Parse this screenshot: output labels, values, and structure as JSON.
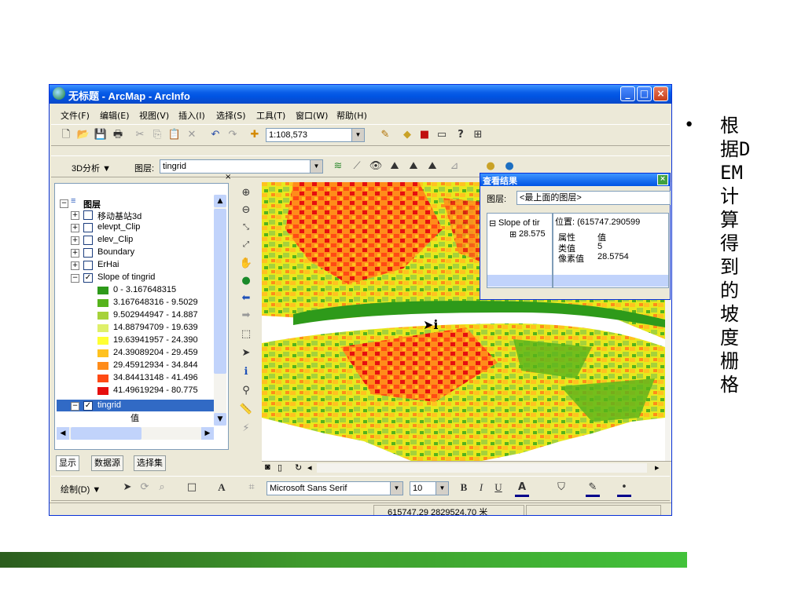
{
  "window": {
    "title": "无标题 - ArcMap - ArcInfo",
    "buttons": {
      "minimize": "_",
      "maximize": "□",
      "close": "×"
    }
  },
  "menu": [
    "文件(F)",
    "编辑(E)",
    "视图(V)",
    "插入(I)",
    "选择(S)",
    "工具(T)",
    "窗口(W)",
    "帮助(H)"
  ],
  "standard_toolbar": {
    "scale": "1:108,573"
  },
  "analyst_toolbar": {
    "analyst_label": "3D分析 ▼",
    "layer_label": "图层:",
    "layer_value": "tingrid"
  },
  "toc": {
    "root_label": "图层",
    "layers": [
      {
        "label": "移动基站3d",
        "checked": false
      },
      {
        "label": "elevpt_Clip",
        "checked": false
      },
      {
        "label": "elev_Clip",
        "checked": false
      },
      {
        "label": "Boundary",
        "checked": false
      },
      {
        "label": "ErHai",
        "checked": false
      },
      {
        "label": "Slope of tingrid",
        "checked": true
      }
    ],
    "legend": [
      {
        "label": "0 - 3.167648315",
        "color": "#2e9a1a"
      },
      {
        "label": "3.167648316 - 9.5029",
        "color": "#56b31c"
      },
      {
        "label": "9.502944947 - 14.887",
        "color": "#a6d23a"
      },
      {
        "label": "14.88794709 - 19.639",
        "color": "#dff06a"
      },
      {
        "label": "19.63941957 - 24.390",
        "color": "#ffff33"
      },
      {
        "label": "24.39089204 - 29.459",
        "color": "#ffc21f"
      },
      {
        "label": "29.45912934 - 34.844",
        "color": "#ff8c1a"
      },
      {
        "label": "34.84413148 - 41.496",
        "color": "#ff4a14"
      },
      {
        "label": "41.49619294 - 80.775",
        "color": "#e60f0f"
      }
    ],
    "selected_layer": {
      "label": "tingrid",
      "checked": true,
      "sublabel": "值"
    },
    "tabs": [
      "显示",
      "数据源",
      "选择集"
    ]
  },
  "identify": {
    "title": "查看结果",
    "layer_label": "图层:",
    "layer_value": "<最上面的图层>",
    "tree_root": "Slope of tir",
    "tree_child": "28.575",
    "location": "位置: (615747.290599",
    "table_headers": [
      "属性",
      "值"
    ],
    "table_rows": [
      [
        "类值",
        "5"
      ],
      [
        "像素值",
        "28.5754"
      ]
    ]
  },
  "draw_toolbar": {
    "draw_label": "绘制(D) ▼",
    "font": "Microsoft Sans Serif",
    "size": "10",
    "bold": "B",
    "italic": "I",
    "underline": "U"
  },
  "status": {
    "coordinates": "615747.29  2829524.70 米"
  },
  "slide_bullet": "根据DEM计算得到的坡度栅格",
  "colors": {
    "titlebar": "#0054e3",
    "green_bar_end": "#42c23a"
  }
}
